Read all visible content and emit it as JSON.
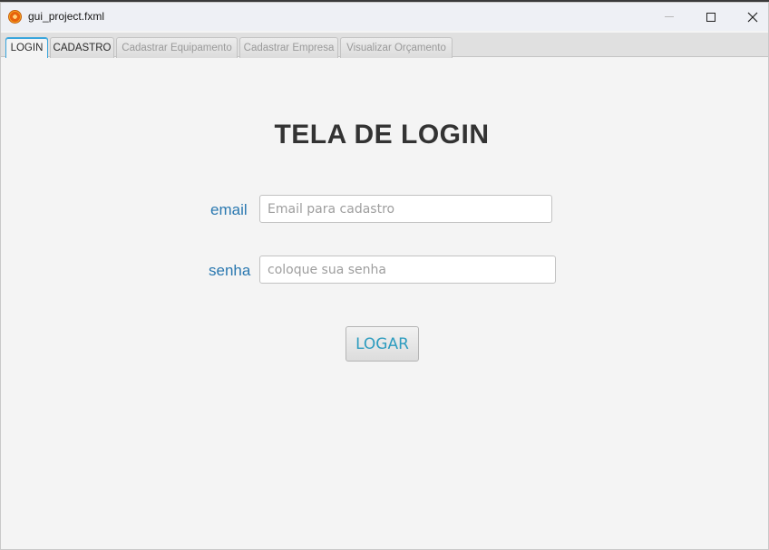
{
  "window": {
    "title": "gui_project.fxml"
  },
  "tabs": [
    {
      "label": "LOGIN",
      "state": "active"
    },
    {
      "label": "CADASTRO",
      "state": "enabled"
    },
    {
      "label": "Cadastrar Equipamento",
      "state": "disabled"
    },
    {
      "label": "Cadastrar Empresa",
      "state": "disabled"
    },
    {
      "label": "Visualizar Orçamento",
      "state": "disabled"
    }
  ],
  "login": {
    "title": "TELA DE LOGIN",
    "email_label": "email",
    "email_placeholder": "Email para cadastro",
    "email_value": "",
    "senha_label": "senha",
    "senha_placeholder": "coloque sua senha",
    "senha_value": "",
    "submit_label": "LOGAR"
  },
  "colors": {
    "accent": "#39a5dc",
    "label_blue": "#2a78b0",
    "button_text": "#2d9cbf",
    "title_text": "#333333"
  }
}
